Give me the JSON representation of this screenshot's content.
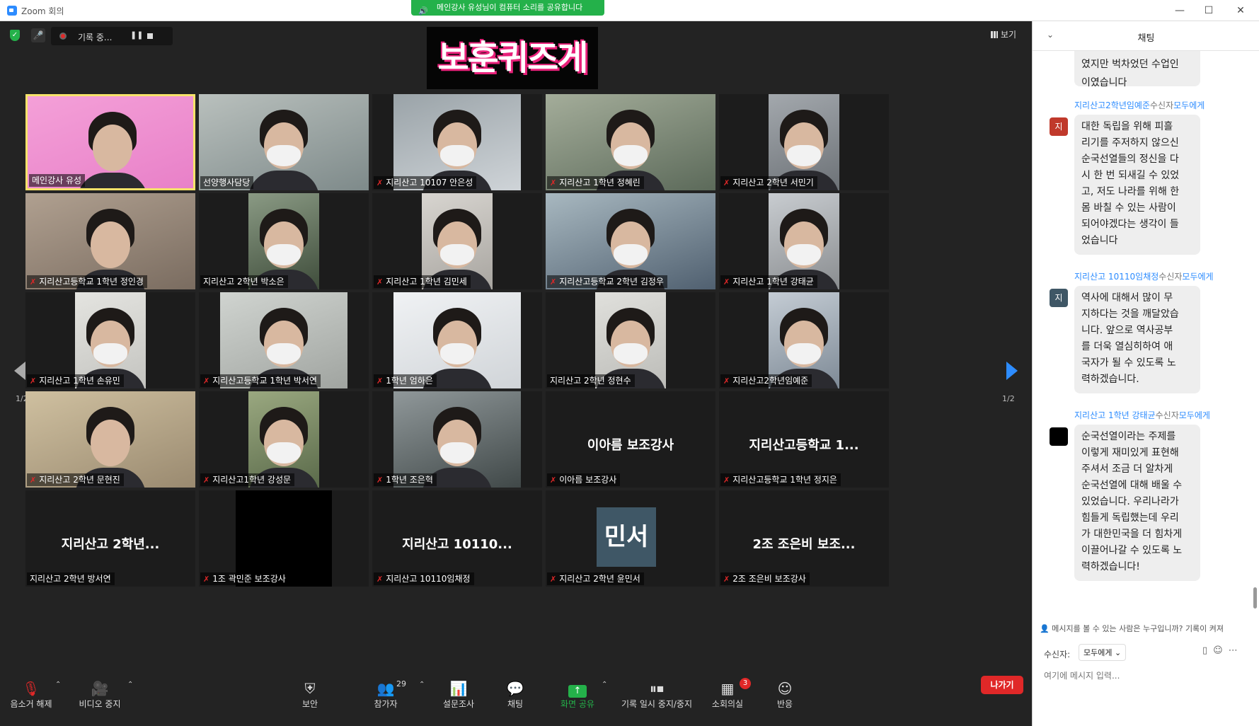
{
  "window": {
    "title": "Zoom 회의",
    "minimize": "—",
    "maximize": "☐",
    "close": "✕"
  },
  "share_banner": "메인강사 유성님이 컴퓨터 소리를 공유합니다",
  "top_bar": {
    "recording_label": "기록 중...",
    "view_label": "보기"
  },
  "quiz_logo": "보훈퀴즈게임",
  "page_indicator": "1/2",
  "tiles": [
    {
      "name": "메인강사 유성",
      "kind": "video",
      "active": true
    },
    {
      "name": "선양행사담당",
      "kind": "video"
    },
    {
      "name": "지리산고 10107 안은성",
      "kind": "video"
    },
    {
      "name": "지리산고 1학년 정혜린",
      "kind": "video"
    },
    {
      "name": "지리산고 2학년 서민기",
      "kind": "video"
    },
    {
      "name": "지리산고등학교 1학년 정인경",
      "kind": "video"
    },
    {
      "name": "지리산고 2학년 박소은",
      "kind": "video"
    },
    {
      "name": "지리산고 1학년 김민세",
      "kind": "video"
    },
    {
      "name": "지리산고등학교 2학년 김정우",
      "kind": "video"
    },
    {
      "name": "지리산고 1학년 강태균",
      "kind": "video"
    },
    {
      "name": "지리산고 1학년 손유민",
      "kind": "video"
    },
    {
      "name": "지리산고등학교 1학년 박서연",
      "kind": "video"
    },
    {
      "name": "1학년 엄하은",
      "kind": "video"
    },
    {
      "name": "지리산고 2학년 정현수",
      "kind": "video"
    },
    {
      "name": "지리산고2학년임예준",
      "kind": "video"
    },
    {
      "name": "지리산고 2학년 문현진",
      "kind": "video"
    },
    {
      "name": "지리산고1학년 강성문",
      "kind": "video"
    },
    {
      "name": "1학년 조은혁",
      "kind": "video"
    },
    {
      "name": "이아름 보조강사",
      "kind": "name",
      "big": "이아름 보조강사"
    },
    {
      "name": "지리산고등학교 1학년 정지은",
      "kind": "name",
      "big": "지리산고등학교 1..."
    },
    {
      "name": "지리산고 2학년 방서연",
      "kind": "name",
      "big": "지리산고 2학년..."
    },
    {
      "name": "1조 곽민준 보조강사",
      "kind": "black"
    },
    {
      "name": "지리산고 10110임채정",
      "kind": "name",
      "big": "지리산고 10110..."
    },
    {
      "name": "지리산고 2학년 윤민서",
      "kind": "avatar",
      "big": "민서"
    },
    {
      "name": "2조 조은비 보조강사",
      "kind": "name",
      "big": "2조 조은비 보조..."
    }
  ],
  "toolbar": {
    "unmute": "음소거 해제",
    "stop_video": "비디오 중지",
    "security": "보안",
    "participants": "참가자",
    "participant_count": "29",
    "polls": "설문조사",
    "chat": "채팅",
    "share_screen": "화면 공유",
    "pause_recording": "기록 일시 중지/중지",
    "breakout_rooms": "소회의실",
    "breakout_badge": "3",
    "reactions": "반응",
    "leave": "나가기"
  },
  "chat": {
    "title": "채팅",
    "first_message": "였지만 벅차었던 수업인\n이였습니다",
    "messages": [
      {
        "sender": "지리산고2학년임예준",
        "to_prefix": "수신자",
        "to": "모두에게",
        "avatar": "지",
        "avatar_color": "#c0392b",
        "text": "대한 독립을 위해 피흘\n리기를 주저하지 않으신\n순국선열들의 정신을 다\n시 한 번 되새길 수 있었\n고, 저도 나라를 위해 한\n몸 바칠 수 있는 사람이\n되어야겠다는 생각이 들\n었습니다"
      },
      {
        "sender": "지리산고 10110임채정",
        "to_prefix": "수신자",
        "to": "모두에게",
        "avatar": "지",
        "avatar_color": "#3f5766",
        "text": "역사에 대해서 많이 무\n지하다는 것을 깨달았습\n니다. 앞으로 역사공부\n를 더욱 열심히하여 애\n국자가 될 수 있도록 노\n력하겠습니다."
      },
      {
        "sender": "지리산고 1학년 강태균",
        "to_prefix": "수신자",
        "to": "모두에게",
        "avatar": "",
        "avatar_color": "#000000",
        "text": "순국선열이라는 주제를\n이렇게 재미있게 표현해\n주셔서 조금 더 알차게\n순국선열에 대해 배울 수\n있었습니다. 우리나라가\n힘들게 독립했는데 우리\n가 대한민국을 더 힘차게\n이끌어나갈 수 있도록 노\n력하겠습니다!"
      }
    ],
    "privacy_note": "메시지를 볼 수 있는 사람은 누구입니까? 기록이 켜져",
    "recipient_label": "수신자:",
    "recipient_value": "모두에게 ⌄",
    "input_placeholder": "여기에 메시지 입력..."
  },
  "colors": {
    "accent": "#2d8cff",
    "share_green": "#24b14a",
    "leave_red": "#e02828",
    "active_border": "#f6e36a"
  }
}
